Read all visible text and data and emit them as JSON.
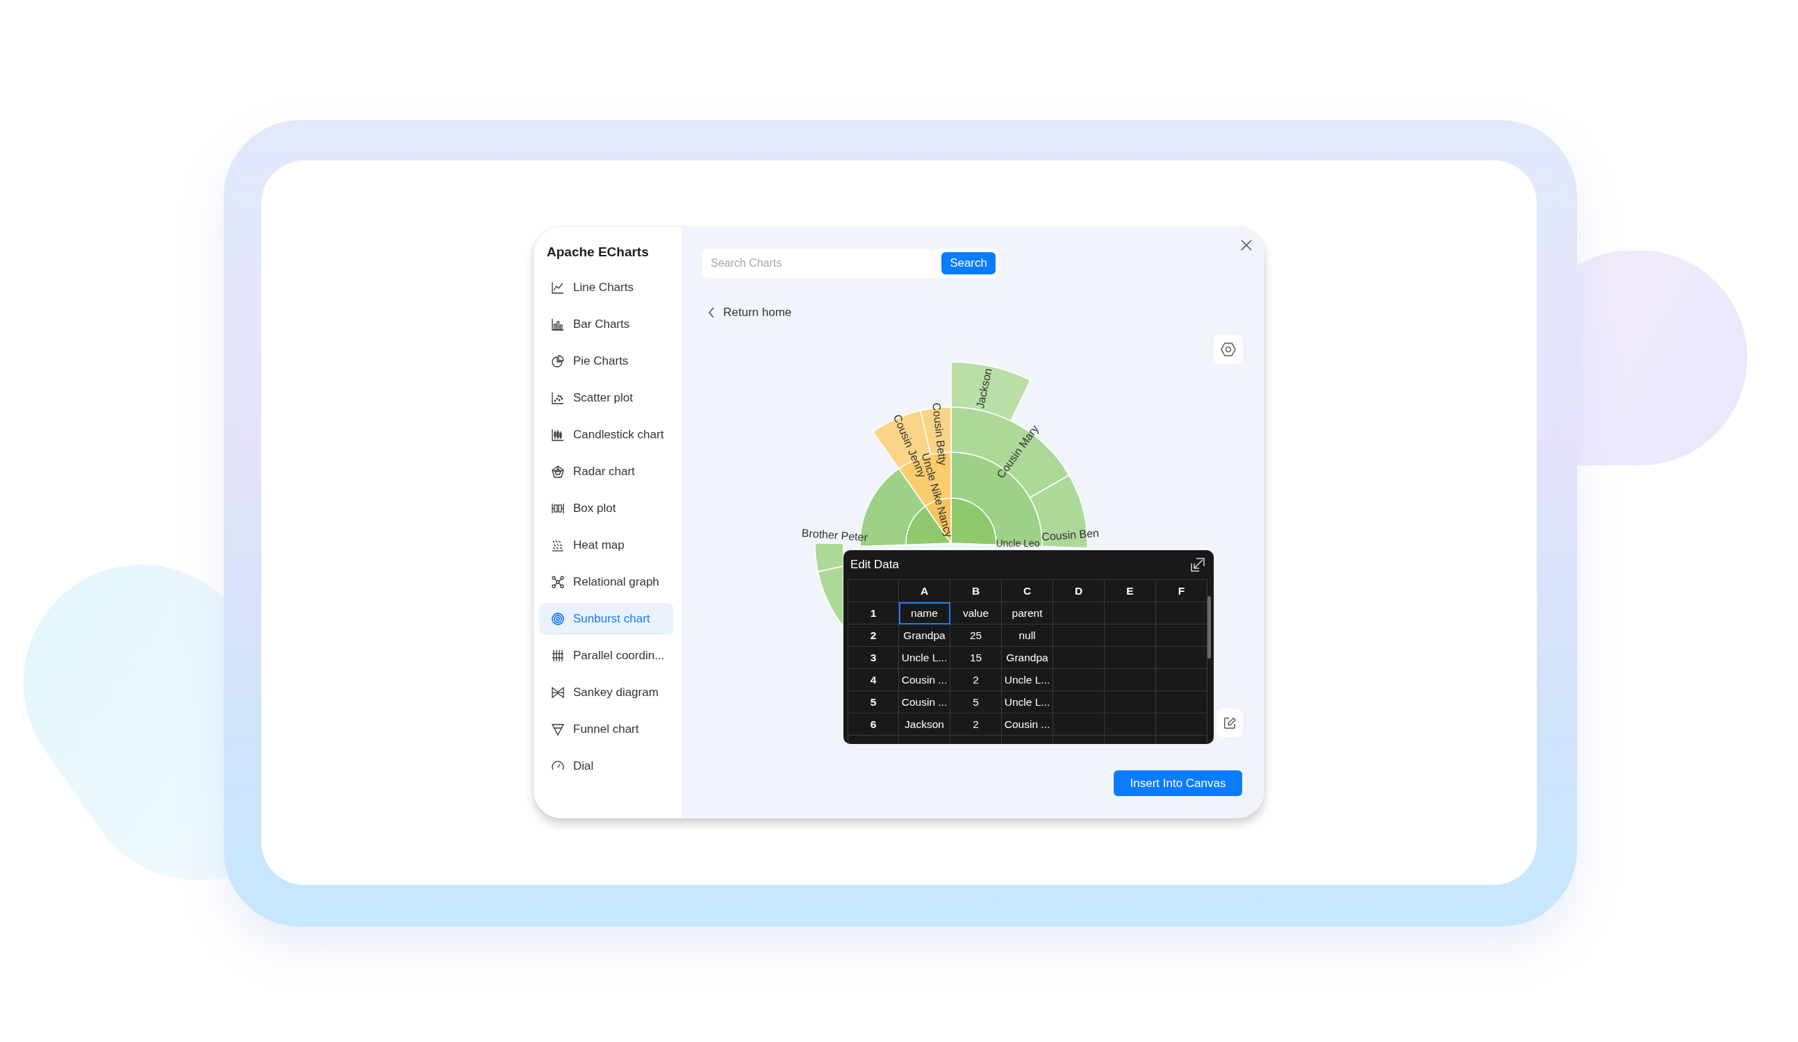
{
  "sidebar": {
    "title": "Apache ECharts",
    "items": [
      {
        "label": "Line Charts",
        "selected": false
      },
      {
        "label": "Bar Charts",
        "selected": false
      },
      {
        "label": "Pie Charts",
        "selected": false
      },
      {
        "label": "Scatter plot",
        "selected": false
      },
      {
        "label": "Candlestick chart",
        "selected": false
      },
      {
        "label": "Radar chart",
        "selected": false
      },
      {
        "label": "Box plot",
        "selected": false
      },
      {
        "label": "Heat map",
        "selected": false
      },
      {
        "label": "Relational graph",
        "selected": false
      },
      {
        "label": "Sunburst chart",
        "selected": true
      },
      {
        "label": "Parallel coordin...",
        "selected": false
      },
      {
        "label": "Sankey diagram",
        "selected": false
      },
      {
        "label": "Funnel chart",
        "selected": false
      },
      {
        "label": "Dial",
        "selected": false
      }
    ]
  },
  "main": {
    "search": {
      "placeholder": "Search Charts",
      "button": "Search"
    },
    "back_link": "Return home",
    "chart": {
      "labels": [
        "Jackson",
        "Cousin Mary",
        "Cousin Betty",
        "Cousin Jenny",
        "Uncle Nike",
        "Nancy",
        "Cousin Ben",
        "Uncle Leo",
        "Brother Peter"
      ]
    },
    "edit_data": {
      "title": "Edit Data",
      "columns": [
        "A",
        "B",
        "C",
        "D",
        "E",
        "F"
      ],
      "rows": [
        {
          "header": "1",
          "cells": [
            {
              "text": "name",
              "selected": true
            },
            {
              "text": "value",
              "selected": false
            },
            {
              "text": "parent",
              "selected": false
            }
          ]
        },
        {
          "header": "2",
          "cells": [
            {
              "text": "Grandpa",
              "selected": false
            },
            {
              "text": "25",
              "selected": false
            },
            {
              "text": "null",
              "selected": false
            }
          ]
        },
        {
          "header": "3",
          "cells": [
            {
              "text": "Uncle L...",
              "selected": false
            },
            {
              "text": "15",
              "selected": false
            },
            {
              "text": "Grandpa",
              "selected": false
            }
          ]
        },
        {
          "header": "4",
          "cells": [
            {
              "text": "Cousin ...",
              "selected": false
            },
            {
              "text": "2",
              "selected": false
            },
            {
              "text": "Uncle L...",
              "selected": false
            }
          ]
        },
        {
          "header": "5",
          "cells": [
            {
              "text": "Cousin ...",
              "selected": false
            },
            {
              "text": "5",
              "selected": false
            },
            {
              "text": "Uncle L...",
              "selected": false
            }
          ]
        },
        {
          "header": "6",
          "cells": [
            {
              "text": "Jackson",
              "selected": false
            },
            {
              "text": "2",
              "selected": false
            },
            {
              "text": "Cousin ...",
              "selected": false
            }
          ]
        }
      ]
    },
    "insert_button": "Insert Into Canvas"
  }
}
